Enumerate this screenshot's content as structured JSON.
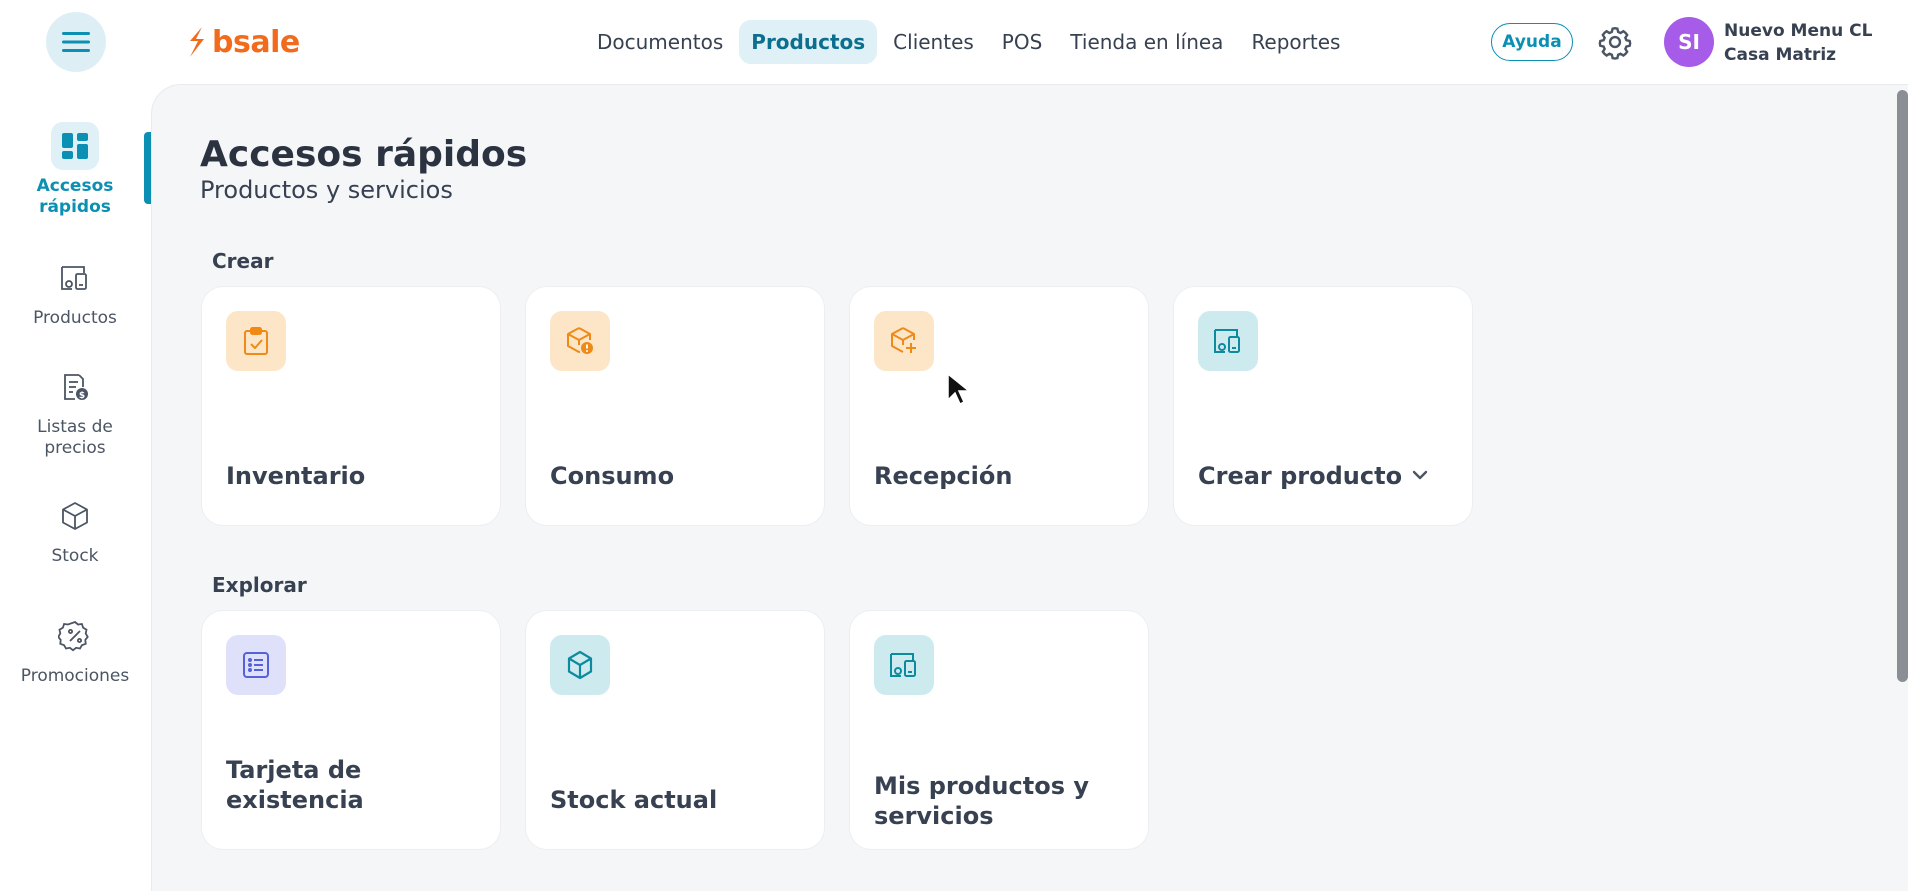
{
  "brand": {
    "name": "bsale",
    "color": "#f26b1d"
  },
  "nav": [
    "Documentos",
    "Productos",
    "Clientes",
    "POS",
    "Tienda en línea",
    "Reportes"
  ],
  "header": {
    "help_label": "Ayuda",
    "avatar_initials": "SI",
    "user_name": "Nuevo Menu CL",
    "user_branch": "Casa Matriz"
  },
  "sidebar": {
    "items": [
      {
        "label": "Accesos rápidos",
        "icon": "dashboard-icon",
        "active": true
      },
      {
        "label": "Productos",
        "icon": "products-icon",
        "active": false
      },
      {
        "label": "Listas de precios",
        "icon": "price-list-icon",
        "active": false
      },
      {
        "label": "Stock",
        "icon": "box-icon",
        "active": false
      },
      {
        "label": "Promociones",
        "icon": "discount-icon",
        "active": false
      }
    ]
  },
  "page": {
    "title": "Accesos rápidos",
    "subtitle": "Productos y servicios"
  },
  "sections": {
    "crear": {
      "title": "Crear",
      "cards": [
        {
          "label": "Inventario",
          "icon": "clipboard-check-icon"
        },
        {
          "label": "Consumo",
          "icon": "box-alert-icon"
        },
        {
          "label": "Recepción",
          "icon": "box-plus-icon"
        },
        {
          "label": "Crear producto",
          "icon": "products-icon"
        }
      ]
    },
    "explorar": {
      "title": "Explorar",
      "cards": [
        {
          "label": "Tarjeta de existencia",
          "icon": "list-icon"
        },
        {
          "label": "Stock actual",
          "icon": "box-icon"
        },
        {
          "label": "Mis productos y servicios",
          "icon": "products-icon"
        }
      ]
    }
  },
  "colors": {
    "accent": "#0b8fb3",
    "orange_tile": "#fde6c8",
    "orange_icon": "#ef8a16",
    "teal_tile": "#cdebef",
    "teal_icon": "#0e8a9e",
    "violet_tile": "#dfe1fb",
    "violet_icon": "#5561d6"
  }
}
